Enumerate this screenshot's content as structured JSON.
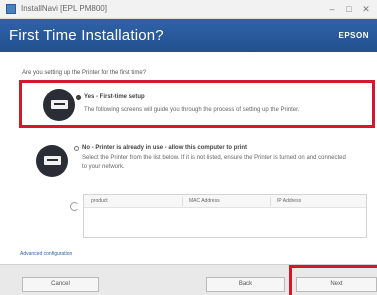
{
  "window": {
    "title": "InstallNavi [EPL PM800]",
    "controls": {
      "minimize": "–",
      "maximize": "□",
      "close": "✕"
    }
  },
  "header": {
    "heading": "First Time Installation?",
    "brand": "EPSON",
    "color": "#2a5a9c"
  },
  "question": "Are you setting up the Printer for the first time?",
  "options": [
    {
      "title": "Yes - First-time setup",
      "description": "The following screens will guide you through the process of setting up the Printer.",
      "selected": true,
      "icon": "printer-icon"
    },
    {
      "title": "No - Printer is already in use - allow this computer to print",
      "description": "Select the Printer from the list below. If it is not listed, ensure the Printer is turned on and connected to your network.",
      "selected": false,
      "icon": "printer-icon"
    }
  ],
  "printer_table": {
    "columns": [
      "product",
      "MAC Address",
      "IP Address"
    ],
    "rows": []
  },
  "advanced_link": "Advanced configuration",
  "footer": {
    "cancel_label": "Cancel",
    "back_label": "Back",
    "next_label": "Next"
  },
  "colors": {
    "accent": "#2a5a9c",
    "highlight": "#d3182d"
  }
}
